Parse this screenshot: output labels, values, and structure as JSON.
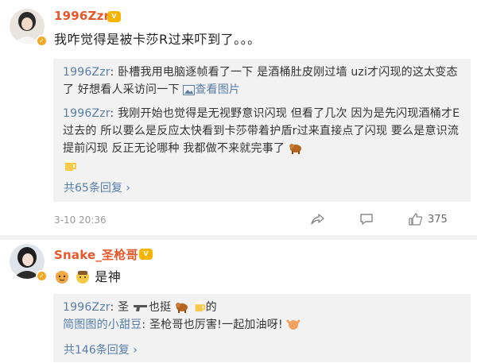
{
  "comments": [
    {
      "username": "1996Zzr",
      "vip_badge": "V",
      "text": "我咋觉得是被卡莎R过来吓到了。。。",
      "replies": [
        {
          "name": "1996Zzr",
          "text": "卧槽我用电脑逐帧看了一下 是酒桶肚皮刚过墙 uzi才闪现的这太变态了 好想看人采访问一下",
          "link_text": "查看图片"
        },
        {
          "name": "1996Zzr",
          "text": "我刚开始也觉得是无视野意识闪现 但看了几次 因为是先闪现酒桶才E过去的 所以要么是反应太快看到卡莎带着护盾r过来直接点了闪现  要么是意识流提前闪现  反正无论哪种 我都做不来就完事了"
        }
      ],
      "more_replies": "共65条回复",
      "time": "3-10 20:36",
      "like_count": "375"
    },
    {
      "username": "Snake_圣枪哥",
      "vip_badge": "V",
      "text": "是神",
      "replies": [
        {
          "name": "1996Zzr",
          "text_a": "圣",
          "text_b": "也挺",
          "text_c": "的"
        },
        {
          "name": "简图图的小甜豆",
          "text": "圣枪哥也厉害!一起加油呀!"
        }
      ],
      "more_replies": "共146条回复"
    }
  ],
  "colors": {
    "username": "#e8562a",
    "link": "#567dab",
    "reply_bg": "#f2f2f2",
    "divider": "#f2f2f2"
  }
}
